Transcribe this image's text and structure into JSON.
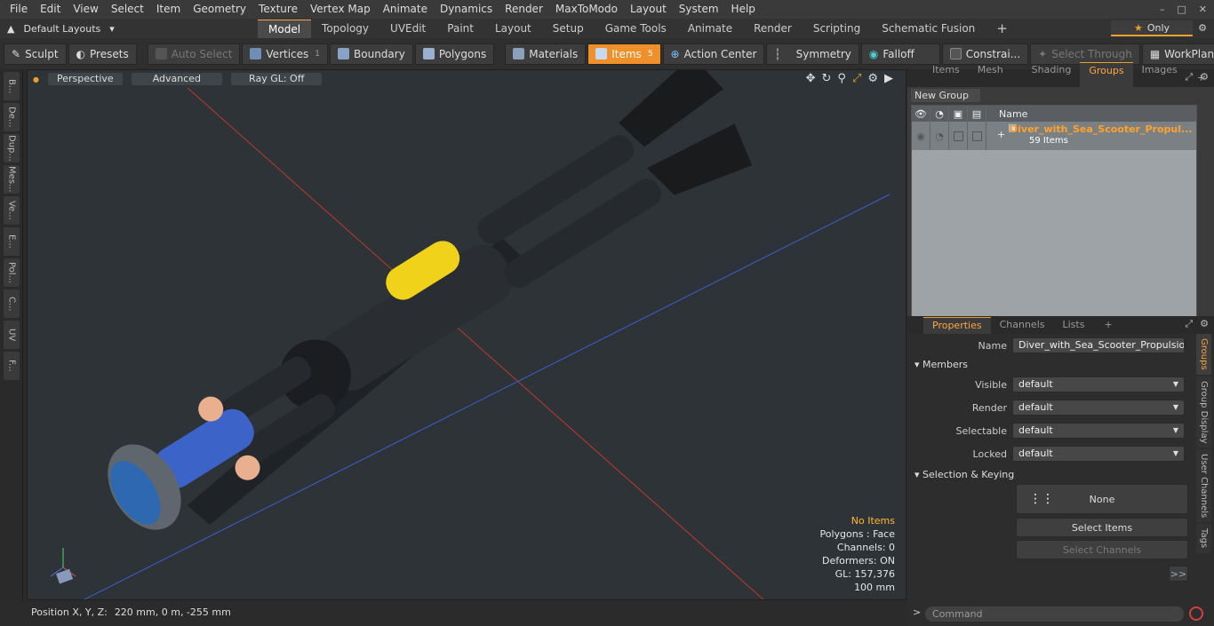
{
  "menu": [
    "File",
    "Edit",
    "View",
    "Select",
    "Item",
    "Geometry",
    "Texture",
    "Vertex Map",
    "Animate",
    "Dynamics",
    "Render",
    "MaxToModo",
    "Layout",
    "System",
    "Help"
  ],
  "layouts": {
    "label": "Default Layouts",
    "tabs": [
      "Model",
      "Topology",
      "UVEdit",
      "Paint",
      "Layout",
      "Setup",
      "Game Tools",
      "Animate",
      "Render",
      "Scripting",
      "Schematic Fusion"
    ],
    "active": "Model",
    "plus": "+",
    "only": "Only"
  },
  "toolbar": {
    "sculpt": "Sculpt",
    "presets": "Presets",
    "auto_select": "Auto Select",
    "vertices": "Vertices",
    "vertices_count": "1",
    "boundary": "Boundary",
    "polygons": "Polygons",
    "materials": "Materials",
    "items": "Items",
    "items_count": "5",
    "action_center": "Action Center",
    "symmetry": "Symmetry",
    "falloff": "Falloff",
    "constraints": "Constrai...",
    "select_through": "Select Through",
    "workplane": "WorkPlane"
  },
  "left_tabs": [
    "B...",
    "De...",
    "Dup...",
    "Mes...",
    "Ve...",
    "E...",
    "Pol...",
    "C...",
    "UV",
    "F..."
  ],
  "viewport": {
    "perspective": "Perspective",
    "advanced": "Advanced",
    "raygl": "Ray GL: Off",
    "hud": {
      "items": "No Items",
      "polygons": "Polygons : Face",
      "channels": "Channels: 0",
      "deformers": "Deformers: ON",
      "gl": "GL: 157,376",
      "scale": "100 mm"
    }
  },
  "status": {
    "position": "Position X, Y, Z:",
    "value": "220 mm, 0 m, -255 mm"
  },
  "panel_tabs": {
    "tabs": [
      "Items",
      "Mesh ...",
      "Shading",
      "Groups",
      "Images"
    ],
    "active": "Groups",
    "plus": "+"
  },
  "groups": {
    "new_group": "New Group",
    "name_header": "Name",
    "group_name": "Diver_with_Sea_Scooter_Propul...",
    "group_count": "59 Items"
  },
  "props_tabs": {
    "tabs": [
      "Properties",
      "Channels",
      "Lists"
    ],
    "active": "Properties",
    "plus": "+"
  },
  "side_tabs": [
    "Groups",
    "Group Display",
    "User Channels",
    "Tags"
  ],
  "properties": {
    "name_label": "Name",
    "name_value": "Diver_with_Sea_Scooter_Propulsion_\\",
    "members": "Members",
    "visible_label": "Visible",
    "visible_value": "default",
    "render_label": "Render",
    "render_value": "default",
    "selectable_label": "Selectable",
    "selectable_value": "default",
    "locked_label": "Locked",
    "locked_value": "default",
    "selkey": "Selection & Keying",
    "none": "None",
    "select_items": "Select Items",
    "select_channels": "Select Channels",
    "more": ">>"
  },
  "command": {
    "placeholder": "Command"
  },
  "colors": {
    "accent": "#f0902a",
    "viewport_bg": "#2e3338"
  }
}
